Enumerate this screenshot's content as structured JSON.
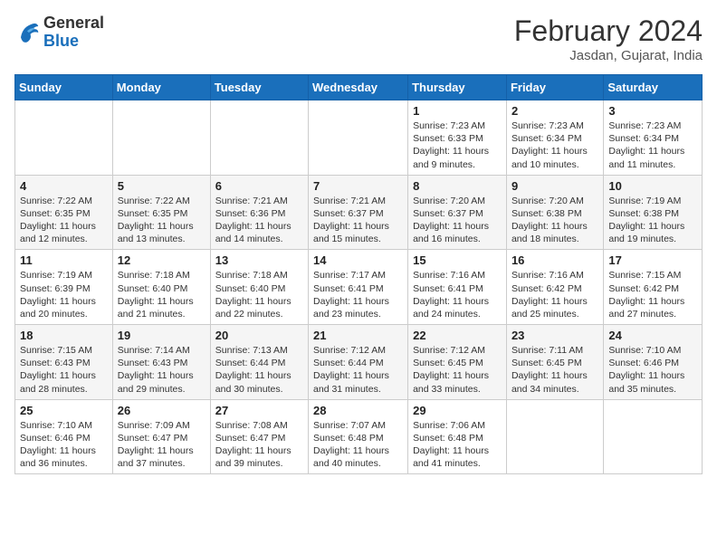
{
  "header": {
    "logo_general": "General",
    "logo_blue": "Blue",
    "title": "February 2024",
    "location": "Jasdan, Gujarat, India"
  },
  "weekdays": [
    "Sunday",
    "Monday",
    "Tuesday",
    "Wednesday",
    "Thursday",
    "Friday",
    "Saturday"
  ],
  "weeks": [
    [
      {
        "day": "",
        "info": ""
      },
      {
        "day": "",
        "info": ""
      },
      {
        "day": "",
        "info": ""
      },
      {
        "day": "",
        "info": ""
      },
      {
        "day": "1",
        "info": "Sunrise: 7:23 AM\nSunset: 6:33 PM\nDaylight: 11 hours and 9 minutes."
      },
      {
        "day": "2",
        "info": "Sunrise: 7:23 AM\nSunset: 6:34 PM\nDaylight: 11 hours and 10 minutes."
      },
      {
        "day": "3",
        "info": "Sunrise: 7:23 AM\nSunset: 6:34 PM\nDaylight: 11 hours and 11 minutes."
      }
    ],
    [
      {
        "day": "4",
        "info": "Sunrise: 7:22 AM\nSunset: 6:35 PM\nDaylight: 11 hours and 12 minutes."
      },
      {
        "day": "5",
        "info": "Sunrise: 7:22 AM\nSunset: 6:35 PM\nDaylight: 11 hours and 13 minutes."
      },
      {
        "day": "6",
        "info": "Sunrise: 7:21 AM\nSunset: 6:36 PM\nDaylight: 11 hours and 14 minutes."
      },
      {
        "day": "7",
        "info": "Sunrise: 7:21 AM\nSunset: 6:37 PM\nDaylight: 11 hours and 15 minutes."
      },
      {
        "day": "8",
        "info": "Sunrise: 7:20 AM\nSunset: 6:37 PM\nDaylight: 11 hours and 16 minutes."
      },
      {
        "day": "9",
        "info": "Sunrise: 7:20 AM\nSunset: 6:38 PM\nDaylight: 11 hours and 18 minutes."
      },
      {
        "day": "10",
        "info": "Sunrise: 7:19 AM\nSunset: 6:38 PM\nDaylight: 11 hours and 19 minutes."
      }
    ],
    [
      {
        "day": "11",
        "info": "Sunrise: 7:19 AM\nSunset: 6:39 PM\nDaylight: 11 hours and 20 minutes."
      },
      {
        "day": "12",
        "info": "Sunrise: 7:18 AM\nSunset: 6:40 PM\nDaylight: 11 hours and 21 minutes."
      },
      {
        "day": "13",
        "info": "Sunrise: 7:18 AM\nSunset: 6:40 PM\nDaylight: 11 hours and 22 minutes."
      },
      {
        "day": "14",
        "info": "Sunrise: 7:17 AM\nSunset: 6:41 PM\nDaylight: 11 hours and 23 minutes."
      },
      {
        "day": "15",
        "info": "Sunrise: 7:16 AM\nSunset: 6:41 PM\nDaylight: 11 hours and 24 minutes."
      },
      {
        "day": "16",
        "info": "Sunrise: 7:16 AM\nSunset: 6:42 PM\nDaylight: 11 hours and 25 minutes."
      },
      {
        "day": "17",
        "info": "Sunrise: 7:15 AM\nSunset: 6:42 PM\nDaylight: 11 hours and 27 minutes."
      }
    ],
    [
      {
        "day": "18",
        "info": "Sunrise: 7:15 AM\nSunset: 6:43 PM\nDaylight: 11 hours and 28 minutes."
      },
      {
        "day": "19",
        "info": "Sunrise: 7:14 AM\nSunset: 6:43 PM\nDaylight: 11 hours and 29 minutes."
      },
      {
        "day": "20",
        "info": "Sunrise: 7:13 AM\nSunset: 6:44 PM\nDaylight: 11 hours and 30 minutes."
      },
      {
        "day": "21",
        "info": "Sunrise: 7:12 AM\nSunset: 6:44 PM\nDaylight: 11 hours and 31 minutes."
      },
      {
        "day": "22",
        "info": "Sunrise: 7:12 AM\nSunset: 6:45 PM\nDaylight: 11 hours and 33 minutes."
      },
      {
        "day": "23",
        "info": "Sunrise: 7:11 AM\nSunset: 6:45 PM\nDaylight: 11 hours and 34 minutes."
      },
      {
        "day": "24",
        "info": "Sunrise: 7:10 AM\nSunset: 6:46 PM\nDaylight: 11 hours and 35 minutes."
      }
    ],
    [
      {
        "day": "25",
        "info": "Sunrise: 7:10 AM\nSunset: 6:46 PM\nDaylight: 11 hours and 36 minutes."
      },
      {
        "day": "26",
        "info": "Sunrise: 7:09 AM\nSunset: 6:47 PM\nDaylight: 11 hours and 37 minutes."
      },
      {
        "day": "27",
        "info": "Sunrise: 7:08 AM\nSunset: 6:47 PM\nDaylight: 11 hours and 39 minutes."
      },
      {
        "day": "28",
        "info": "Sunrise: 7:07 AM\nSunset: 6:48 PM\nDaylight: 11 hours and 40 minutes."
      },
      {
        "day": "29",
        "info": "Sunrise: 7:06 AM\nSunset: 6:48 PM\nDaylight: 11 hours and 41 minutes."
      },
      {
        "day": "",
        "info": ""
      },
      {
        "day": "",
        "info": ""
      }
    ]
  ]
}
